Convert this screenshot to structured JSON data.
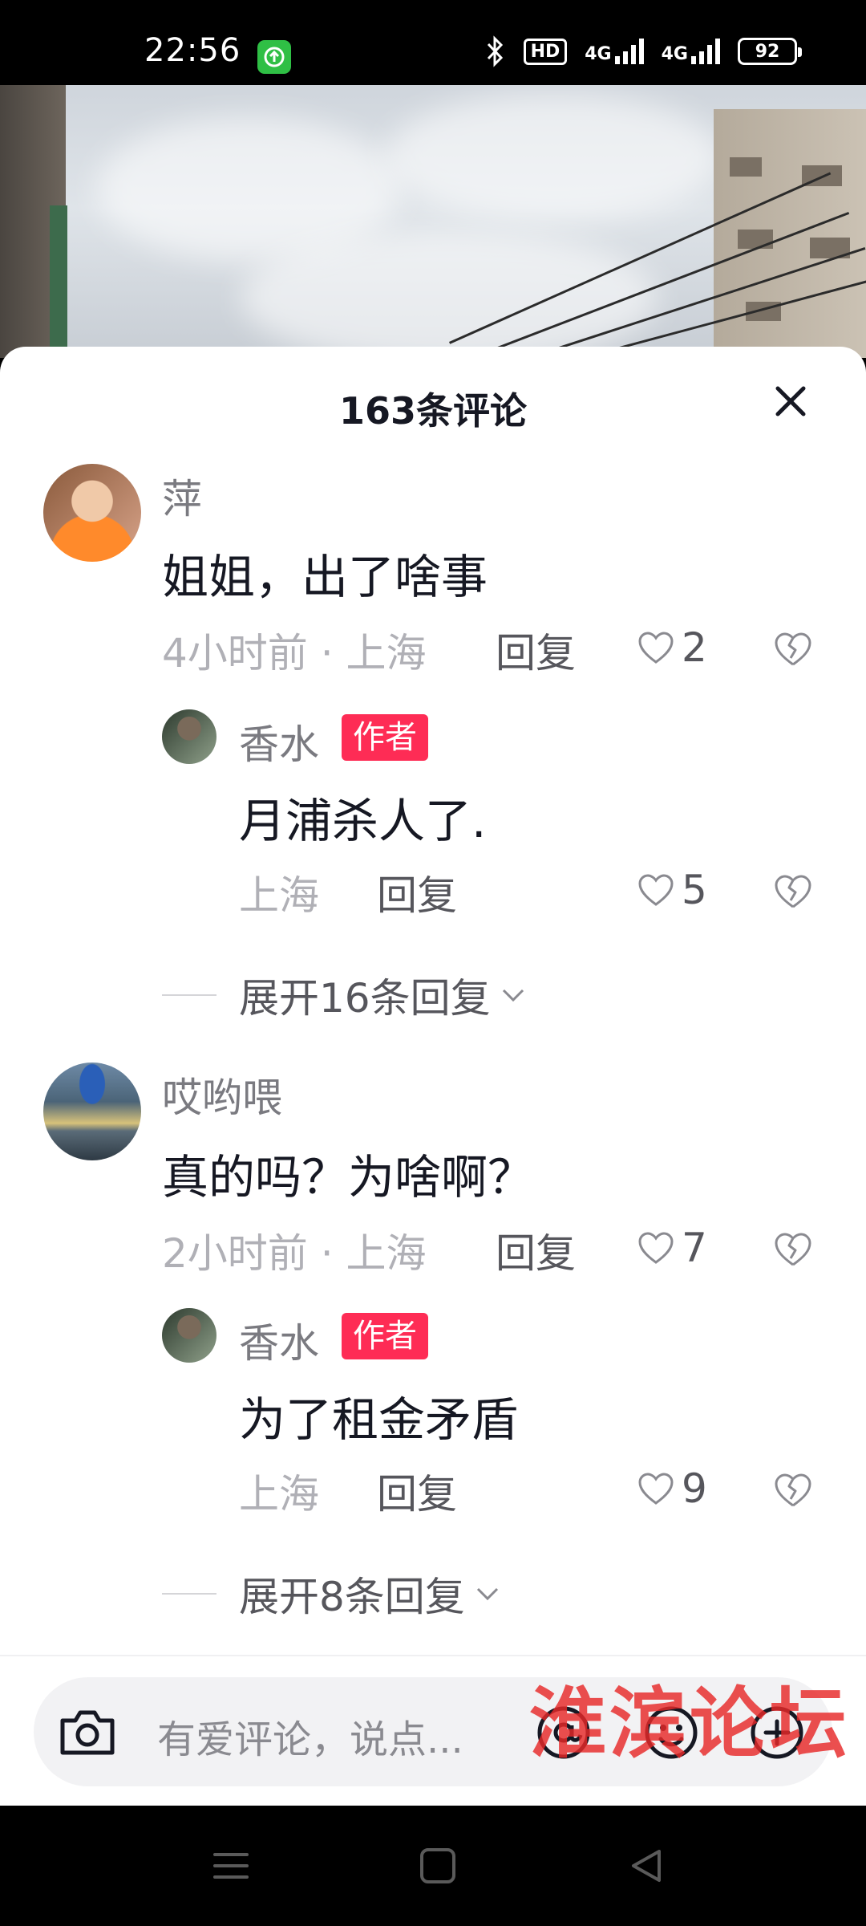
{
  "status_bar": {
    "time": "22:56",
    "hd_label": "HD",
    "net1": "4G",
    "net2": "4G",
    "battery": "92"
  },
  "sheet": {
    "title": "163条评论"
  },
  "comments": [
    {
      "user": "萍",
      "text": "姐姐，出了啥事",
      "meta": "4小时前 · 上海",
      "reply_label": "回复",
      "likes": "2",
      "replies": [
        {
          "user": "香水",
          "tag": "作者",
          "text": "月浦杀人了.",
          "meta": "上海",
          "reply_label": "回复",
          "likes": "5"
        }
      ],
      "expand_label": "展开16条回复"
    },
    {
      "user": "哎哟喂",
      "text": "真的吗？为啥啊？",
      "meta": "2小时前 · 上海",
      "reply_label": "回复",
      "likes": "7",
      "replies": [
        {
          "user": "香水",
          "tag": "作者",
          "text": "为了租金矛盾",
          "meta": "上海",
          "reply_label": "回复",
          "likes": "9"
        }
      ],
      "expand_label": "展开8条回复"
    }
  ],
  "input": {
    "placeholder": "有爱评论，说点..."
  },
  "watermark": "淮滨论坛",
  "colors": {
    "author_tag": "#fe2c55",
    "text_primary": "#161823",
    "text_secondary": "#7a7a80"
  }
}
